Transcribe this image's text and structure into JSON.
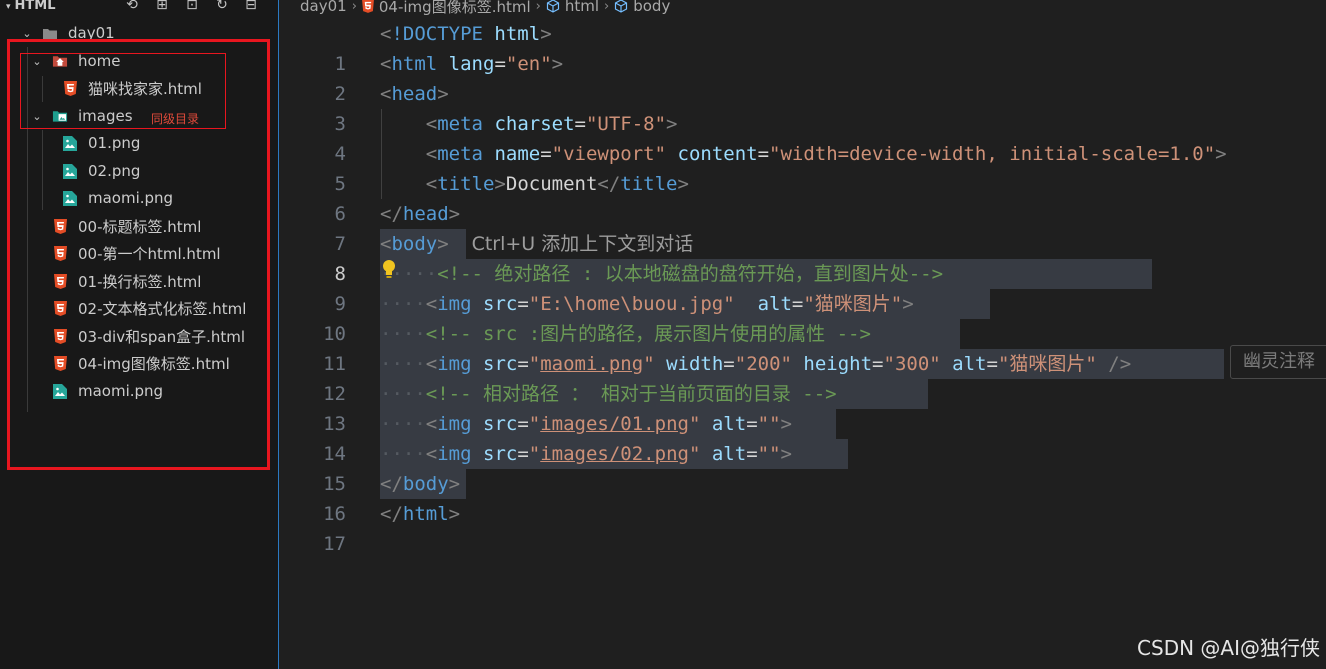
{
  "sidebar": {
    "title": "HTML",
    "actions": [
      {
        "name": "open-editors-icon",
        "glyph": "⟲"
      },
      {
        "name": "new-file-icon",
        "glyph": "⊞"
      },
      {
        "name": "new-folder-icon",
        "glyph": "⊡"
      },
      {
        "name": "refresh-icon",
        "glyph": "↻"
      },
      {
        "name": "collapse-all-icon",
        "glyph": "⊟"
      }
    ],
    "tree": [
      {
        "label": "day01",
        "kind": "folder"
      },
      {
        "label": "home",
        "kind": "folder-home"
      },
      {
        "label": "猫咪找家家.html",
        "kind": "html"
      },
      {
        "label": "images",
        "kind": "folder-images",
        "note": "同级目录"
      },
      {
        "label": "01.png",
        "kind": "image"
      },
      {
        "label": "02.png",
        "kind": "image"
      },
      {
        "label": "maomi.png",
        "kind": "image"
      },
      {
        "label": "00-标题标签.html",
        "kind": "html"
      },
      {
        "label": "00-第一个html.html",
        "kind": "html"
      },
      {
        "label": "01-换行标签.html",
        "kind": "html"
      },
      {
        "label": "02-文本格式化标签.html",
        "kind": "html"
      },
      {
        "label": "03-div和span盒子.html",
        "kind": "html"
      },
      {
        "label": "04-img图像标签.html",
        "kind": "html"
      },
      {
        "label": "maomi.png",
        "kind": "image"
      }
    ]
  },
  "breadcrumb": {
    "folder": "day01",
    "file": "04-img图像标签.html",
    "el1": "html",
    "el2": "body"
  },
  "editor": {
    "line_numbers": [
      "1",
      "2",
      "3",
      "4",
      "5",
      "6",
      "7",
      "8",
      "9",
      "10",
      "11",
      "12",
      "13",
      "14",
      "15",
      "16",
      "17"
    ],
    "active_line": "8",
    "inline_hint": "Ctrl+U 添加上下文到对话",
    "ghost_comment": "幽灵注释",
    "tokens": {
      "doctype": "!DOCTYPE",
      "html": "html",
      "lang": "lang",
      "en": "\"en\"",
      "head": "head",
      "meta": "meta",
      "charset": "charset",
      "utf8": "\"UTF-8\"",
      "name": "name",
      "viewport": "\"viewport\"",
      "content": "content",
      "content_val": "\"width=device-width, initial-scale=1.0\"",
      "title": "title",
      "document": "Document",
      "body": "body",
      "comment1": "<!-- 绝对路径 : 以本地磁盘的盘符开始，直到图片处-->",
      "img": "img",
      "src": "src",
      "alt": "alt",
      "width": "width",
      "height": "height",
      "src1": "\"E:\\home\\buou.jpg\"",
      "alt1": "\"猫咪图片\"",
      "comment2": "<!-- src :图片的路径，展示图片使用的属性 -->",
      "src2": "maomi.png",
      "width_val": "\"200\"",
      "height_val": "\"300\"",
      "comment3": "<!-- 相对路径 ： 相对于当前页面的目录 -->",
      "src3": "images/01.png",
      "src4": "images/02.png",
      "empty": "\"\""
    }
  },
  "watermark": "CSDN @AI@独行侠",
  "colors": {
    "annotation_red": "#e8161f",
    "html_icon": "#e44d26",
    "image_icon": "#26a69a",
    "home_icon": "#e8453c",
    "tag_blue": "#569cd6",
    "attr_lightblue": "#9cdcfe",
    "string_orange": "#ce9178",
    "comment_green": "#6a9955"
  }
}
